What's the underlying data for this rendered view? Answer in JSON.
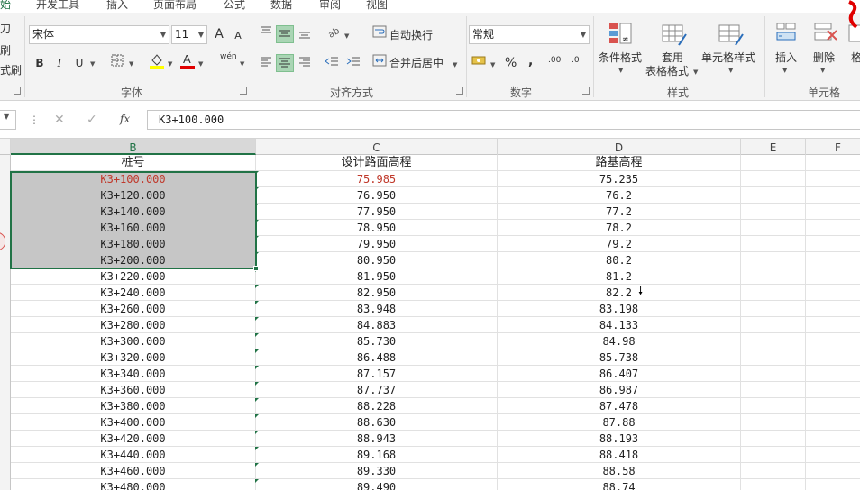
{
  "tabs": [
    {
      "label": "始",
      "active": true
    },
    {
      "label": "开发工具"
    },
    {
      "label": "插入"
    },
    {
      "label": "页面布局"
    },
    {
      "label": "公式"
    },
    {
      "label": "数据"
    },
    {
      "label": "审阅"
    },
    {
      "label": "视图"
    }
  ],
  "clipboard": {
    "label1": "刀",
    "label2": "刷",
    "label3": "式刷"
  },
  "font": {
    "name": "宋体",
    "size": "11",
    "group_label": "字体",
    "bold": "B",
    "italic": "I",
    "underline": "U",
    "grow": "A",
    "shrink": "A",
    "phonetic": "wén"
  },
  "align": {
    "wrap_label": "自动换行",
    "merge_label": "合并后居中",
    "group_label": "对齐方式"
  },
  "number": {
    "format": "常规",
    "percent": "%",
    "comma": ",",
    "inc": ".00",
    "dec": ".0",
    "group_label": "数字"
  },
  "styles": {
    "conditional": "条件格式",
    "table1": "套用",
    "table2": "表格格式",
    "cell": "单元格样式",
    "group_label": "样式"
  },
  "cells_group": {
    "insert": "插入",
    "delete": "删除",
    "format": "格",
    "group_label": "单元格"
  },
  "formula_bar": {
    "cancel": "✕",
    "confirm": "✓",
    "fx": "fx",
    "value": "K3+100.000"
  },
  "columns": [
    "B",
    "C",
    "D",
    "E",
    "F"
  ],
  "header_row": {
    "b": "桩号",
    "c": "设计路面高程",
    "d": "路基高程"
  },
  "rows": [
    {
      "b": "K3+100.000",
      "c": "75.985",
      "d": "75.235"
    },
    {
      "b": "K3+120.000",
      "c": "76.950",
      "d": "76.2"
    },
    {
      "b": "K3+140.000",
      "c": "77.950",
      "d": "77.2"
    },
    {
      "b": "K3+160.000",
      "c": "78.950",
      "d": "78.2"
    },
    {
      "b": "K3+180.000",
      "c": "79.950",
      "d": "79.2"
    },
    {
      "b": "K3+200.000",
      "c": "80.950",
      "d": "80.2"
    },
    {
      "b": "K3+220.000",
      "c": "81.950",
      "d": "81.2"
    },
    {
      "b": "K3+240.000",
      "c": "82.950",
      "d": "82.2"
    },
    {
      "b": "K3+260.000",
      "c": "83.948",
      "d": "83.198"
    },
    {
      "b": "K3+280.000",
      "c": "84.883",
      "d": "84.133"
    },
    {
      "b": "K3+300.000",
      "c": "85.730",
      "d": "84.98"
    },
    {
      "b": "K3+320.000",
      "c": "86.488",
      "d": "85.738"
    },
    {
      "b": "K3+340.000",
      "c": "87.157",
      "d": "86.407"
    },
    {
      "b": "K3+360.000",
      "c": "87.737",
      "d": "86.987"
    },
    {
      "b": "K3+380.000",
      "c": "88.228",
      "d": "87.478"
    },
    {
      "b": "K3+400.000",
      "c": "88.630",
      "d": "87.88"
    },
    {
      "b": "K3+420.000",
      "c": "88.943",
      "d": "88.193"
    },
    {
      "b": "K3+440.000",
      "c": "89.168",
      "d": "88.418"
    },
    {
      "b": "K3+460.000",
      "c": "89.330",
      "d": "88.58"
    },
    {
      "b": "K3+480.000",
      "c": "89.490",
      "d": "88.74"
    }
  ],
  "colors": {
    "accent": "#217346",
    "selection": "#c6c6c6",
    "red_text": "#c0392b"
  }
}
